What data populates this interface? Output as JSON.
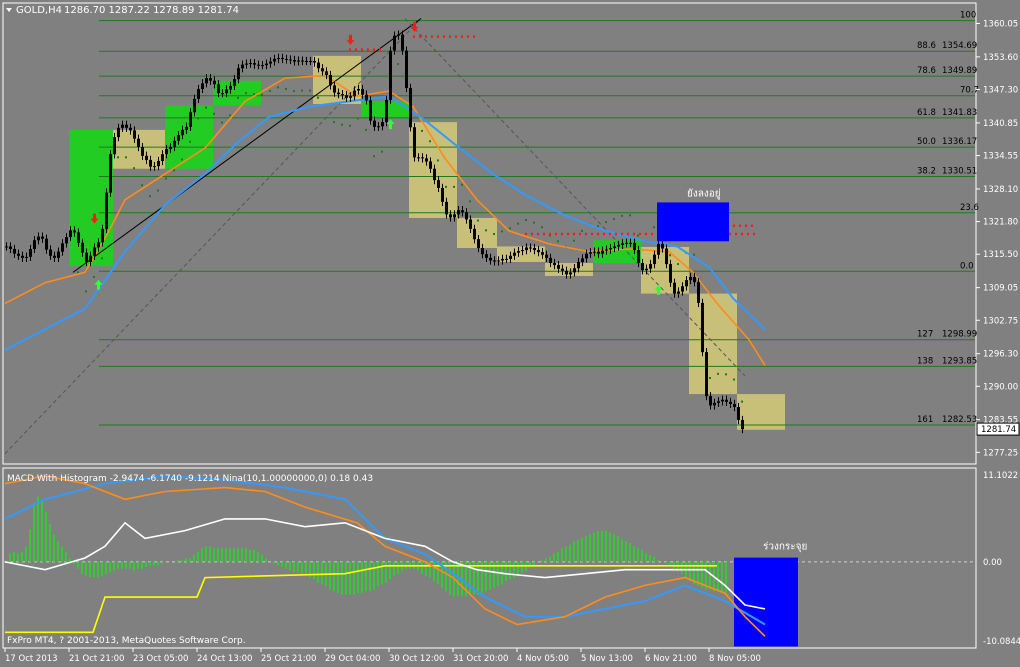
{
  "window": {
    "symbol_title": "GOLD,H4",
    "ohlc": "1286.70 1287.22 1278.89 1281.74",
    "copyright": "FxPro MT4, ? 2001-2013, MetaQuotes Software Corp."
  },
  "colors": {
    "background": "#808080",
    "bull_box": "#22cc22",
    "bear_box": "#c8bf78",
    "grid_level": "#1f7a1f",
    "candle": "#000000",
    "ma_fast": "#ff8c1a",
    "ma_slow": "#3399ff",
    "psar": "#1f7a1f",
    "signal_down": "#ff1a1a",
    "signal_up": "#33ff33",
    "zone": "#0000ff",
    "macd_signal": "#ffffff",
    "macd_yellow": "#ffff00",
    "macd_hist": "#33cc33"
  },
  "chart_data": [
    {
      "type": "candlestick",
      "panel": "price",
      "ylim": [
        1275.0,
        1364.0
      ],
      "y_ticks": [
        1360.05,
        1353.6,
        1347.3,
        1340.85,
        1334.55,
        1328.1,
        1321.8,
        1315.5,
        1309.05,
        1302.75,
        1296.3,
        1290.0,
        1283.55,
        1277.25
      ],
      "current_price": "1281.74",
      "x_ticks": [
        "17 Oct 2013",
        "21 Oct 21:00",
        "23 Oct 05:00",
        "24 Oct 13:00",
        "25 Oct 21:00",
        "29 Oct 04:00",
        "30 Oct 12:00",
        "31 Oct 20:00",
        "4 Nov 05:00",
        "5 Nov 13:00",
        "6 Nov 21:00",
        "8 Nov 05:00"
      ],
      "x_tick_index": [
        0,
        16,
        32,
        48,
        64,
        80,
        96,
        112,
        128,
        144,
        160,
        176
      ],
      "fib_levels": [
        {
          "label": "100",
          "price": 1360.6
        },
        {
          "label": "88.6",
          "value": "1354.69",
          "price": 1354.69
        },
        {
          "label": "78.6",
          "value": "1349.89",
          "price": 1349.89
        },
        {
          "label": "70.7",
          "price": 1346.1
        },
        {
          "label": "61.8",
          "value": "1341.83",
          "price": 1341.83
        },
        {
          "label": "50.0",
          "value": "1336.17",
          "price": 1336.17
        },
        {
          "label": "38.2",
          "value": "1330.51",
          "price": 1330.51
        },
        {
          "label": "23.6",
          "price": 1323.5
        },
        {
          "label": "0.0",
          "price": 1312.2
        },
        {
          "label": "127",
          "value": "1298.99",
          "price": 1298.99
        },
        {
          "label": "138",
          "value": "1293.85",
          "price": 1293.85
        },
        {
          "label": "161",
          "value": "1282.53",
          "price": 1282.53
        }
      ],
      "boxes": [
        {
          "kind": "bull",
          "i0": 16,
          "i1": 27,
          "low": 1313.2,
          "high": 1339.5
        },
        {
          "kind": "bear",
          "i0": 27,
          "i1": 40,
          "low": 1332.0,
          "high": 1339.5
        },
        {
          "kind": "bull",
          "i0": 40,
          "i1": 52,
          "low": 1332.0,
          "high": 1344.2
        },
        {
          "kind": "bull",
          "i0": 52,
          "i1": 64,
          "low": 1344.2,
          "high": 1349.0
        },
        {
          "kind": "bear",
          "i0": 77,
          "i1": 89,
          "low": 1344.5,
          "high": 1353.8
        },
        {
          "kind": "bull",
          "i0": 89,
          "i1": 101,
          "low": 1342.0,
          "high": 1345.0
        },
        {
          "kind": "bear",
          "i0": 101,
          "i1": 113,
          "low": 1322.5,
          "high": 1341.0
        },
        {
          "kind": "bear",
          "i0": 113,
          "i1": 123,
          "low": 1316.7,
          "high": 1322.5
        },
        {
          "kind": "bear",
          "i0": 123,
          "i1": 135,
          "low": 1314.0,
          "high": 1317.0
        },
        {
          "kind": "bear",
          "i0": 135,
          "i1": 147,
          "low": 1311.3,
          "high": 1313.8
        },
        {
          "kind": "bull",
          "i0": 147,
          "i1": 159,
          "low": 1313.8,
          "high": 1318.2
        },
        {
          "kind": "bear",
          "i0": 159,
          "i1": 171,
          "low": 1307.9,
          "high": 1316.9
        },
        {
          "kind": "bear",
          "i0": 171,
          "i1": 183,
          "low": 1288.5,
          "high": 1307.9
        },
        {
          "kind": "bear",
          "i0": 183,
          "i1": 195,
          "low": 1281.6,
          "high": 1288.5
        }
      ],
      "zone": {
        "i0": 163,
        "i1": 181,
        "low": 1318.0,
        "high": 1325.5,
        "label": "ยังลงอยู่"
      },
      "closes": [
        1317.0,
        1316.5,
        1315.6,
        1315.2,
        1314.8,
        1315.0,
        1316.5,
        1318.2,
        1318.9,
        1318.5,
        1316.4,
        1315.2,
        1314.8,
        1316.0,
        1317.6,
        1318.8,
        1320.1,
        1319.7,
        1317.7,
        1315.8,
        1314.0,
        1315.2,
        1316.8,
        1317.8,
        1320.4,
        1327.4,
        1334.8,
        1338.1,
        1339.9,
        1340.5,
        1339.9,
        1339.4,
        1337.8,
        1336.2,
        1334.5,
        1333.7,
        1332.4,
        1332.5,
        1333.5,
        1334.8,
        1335.8,
        1336.2,
        1337.4,
        1338.5,
        1339.5,
        1340.1,
        1342.9,
        1345.5,
        1347.4,
        1348.5,
        1349.5,
        1349.0,
        1348.3,
        1346.6,
        1346.6,
        1347.3,
        1348.0,
        1349.3,
        1351.4,
        1352.1,
        1352.3,
        1352.4,
        1352.1,
        1352.0,
        1352.0,
        1352.3,
        1352.7,
        1353.2,
        1353.4,
        1353.2,
        1353.1,
        1353.0,
        1352.7,
        1352.9,
        1352.8,
        1352.8,
        1352.8,
        1352.5,
        1351.4,
        1350.8,
        1350.1,
        1348.1,
        1346.7,
        1346.4,
        1346.2,
        1345.7,
        1346.0,
        1347.1,
        1347.4,
        1346.3,
        1345.2,
        1341.3,
        1340.1,
        1340.2,
        1341.0,
        1345.3,
        1354.8,
        1357.7,
        1357.9,
        1354.8,
        1347.6,
        1340.0,
        1334.2,
        1334.2,
        1334.0,
        1333.4,
        1332.0,
        1329.8,
        1328.3,
        1325.6,
        1323.2,
        1322.6,
        1323.2,
        1324.0,
        1323.6,
        1322.2,
        1320.4,
        1318.4,
        1316.7,
        1315.5,
        1314.8,
        1314.3,
        1314.1,
        1314.3,
        1314.6,
        1314.6,
        1315.2,
        1315.8,
        1316.1,
        1316.3,
        1316.8,
        1316.7,
        1316.3,
        1315.9,
        1315.4,
        1314.8,
        1313.8,
        1313.4,
        1312.7,
        1312.3,
        1311.6,
        1312.0,
        1312.8,
        1314.0,
        1314.7,
        1315.6,
        1315.9,
        1316.0,
        1315.6,
        1316.2,
        1316.4,
        1316.7,
        1317.0,
        1317.3,
        1317.6,
        1317.7,
        1317.7,
        1316.3,
        1313.8,
        1312.4,
        1312.7,
        1313.6,
        1315.4,
        1317.5,
        1316.6,
        1313.6,
        1310.0,
        1307.9,
        1308.3,
        1309.3,
        1310.5,
        1311.1,
        1310.1,
        1306.1,
        1296.6,
        1288.1,
        1286.3,
        1286.8,
        1287.1,
        1287.4,
        1287.0,
        1286.6,
        1286.0,
        1283.5,
        1281.74
      ],
      "ma_fast": [
        [
          0,
          1306.0
        ],
        [
          10,
          1310.0
        ],
        [
          20,
          1312.0
        ],
        [
          26,
          1320.0
        ],
        [
          30,
          1326.0
        ],
        [
          40,
          1331.0
        ],
        [
          50,
          1336.0
        ],
        [
          60,
          1345.0
        ],
        [
          70,
          1349.5
        ],
        [
          80,
          1350.0
        ],
        [
          88,
          1346.0
        ],
        [
          96,
          1347.0
        ],
        [
          102,
          1344.0
        ],
        [
          110,
          1334.0
        ],
        [
          118,
          1326.0
        ],
        [
          126,
          1320.0
        ],
        [
          136,
          1317.5
        ],
        [
          146,
          1316.0
        ],
        [
          156,
          1316.5
        ],
        [
          166,
          1316.0
        ],
        [
          172,
          1312.0
        ],
        [
          178,
          1306.0
        ],
        [
          186,
          1299.0
        ],
        [
          190,
          1294.0
        ]
      ],
      "ma_slow": [
        [
          0,
          1297.0
        ],
        [
          10,
          1301.0
        ],
        [
          20,
          1305.0
        ],
        [
          30,
          1316.0
        ],
        [
          40,
          1325.0
        ],
        [
          50,
          1331.0
        ],
        [
          58,
          1337.0
        ],
        [
          66,
          1342.0
        ],
        [
          76,
          1344.0
        ],
        [
          86,
          1345.0
        ],
        [
          96,
          1346.0
        ],
        [
          104,
          1342.0
        ],
        [
          112,
          1337.0
        ],
        [
          122,
          1331.0
        ],
        [
          130,
          1327.0
        ],
        [
          140,
          1323.0
        ],
        [
          150,
          1320.0
        ],
        [
          160,
          1318.0
        ],
        [
          168,
          1317.0
        ],
        [
          176,
          1313.0
        ],
        [
          182,
          1307.0
        ],
        [
          190,
          1301.0
        ]
      ],
      "trend_lines": [
        {
          "from": [
            0,
            1277.0
          ],
          "to": [
            104,
            1361.0
          ],
          "style": "dashed"
        },
        {
          "from": [
            17,
            1312.0
          ],
          "to": [
            104,
            1361.0
          ],
          "style": "solid"
        },
        {
          "from": [
            100,
            1361.0
          ],
          "to": [
            185,
            1292.0
          ],
          "style": "dashed"
        }
      ],
      "dotted_levels": [
        {
          "i0": 86,
          "i1": 95,
          "price": 1355.0
        },
        {
          "i0": 102,
          "i1": 118,
          "price": 1357.5
        },
        {
          "i0": 130,
          "i1": 188,
          "price": 1319.4
        },
        {
          "i0": 167,
          "i1": 188,
          "price": 1321.0
        }
      ],
      "arrows": [
        {
          "dir": "down",
          "i": 22,
          "price": 1322.0
        },
        {
          "dir": "up",
          "i": 23,
          "price": 1310.0
        },
        {
          "dir": "down",
          "i": 86,
          "price": 1356.5
        },
        {
          "dir": "up",
          "i": 96,
          "price": 1341.0
        },
        {
          "dir": "down",
          "i": 102,
          "price": 1359.0
        },
        {
          "dir": "up",
          "i": 163,
          "price": 1309.0
        },
        {
          "dir": "down",
          "i": 168,
          "price": 1321.0
        }
      ]
    },
    {
      "type": "macd",
      "panel": "indicator",
      "title": "MACD With Histogram -2.9474 -6.1740 -9.1214  Nina(10,1.00000000,0) 0.18 0.43",
      "ylim": [
        -11.0,
        12.0
      ],
      "y_ticks": [
        "11.1022",
        "0.00",
        "-10.0844"
      ],
      "y_tick_values": [
        11.1022,
        0.0,
        -10.0844
      ],
      "zone": {
        "i0": 183,
        "i1": 199,
        "low": -10.8,
        "high": 0.55,
        "label": "ร่วงกระจุย"
      },
      "macd_blue": [
        [
          0,
          5.5
        ],
        [
          10,
          8.0
        ],
        [
          25,
          10.0
        ],
        [
          40,
          11.0
        ],
        [
          55,
          10.5
        ],
        [
          70,
          9.5
        ],
        [
          85,
          8.0
        ],
        [
          95,
          3.0
        ],
        [
          105,
          1.0
        ],
        [
          112,
          -1.5
        ],
        [
          120,
          -4.5
        ],
        [
          130,
          -7.0
        ],
        [
          140,
          -7.0
        ],
        [
          150,
          -6.0
        ],
        [
          160,
          -5.0
        ],
        [
          170,
          -3.0
        ],
        [
          180,
          -5.0
        ],
        [
          190,
          -8.0
        ]
      ],
      "macd_orange": [
        [
          0,
          10.0
        ],
        [
          10,
          11.0
        ],
        [
          20,
          10.0
        ],
        [
          30,
          8.0
        ],
        [
          40,
          9.0
        ],
        [
          55,
          9.5
        ],
        [
          65,
          9.0
        ],
        [
          75,
          7.0
        ],
        [
          88,
          5.0
        ],
        [
          95,
          2.0
        ],
        [
          105,
          0.0
        ],
        [
          112,
          -2.0
        ],
        [
          120,
          -6.0
        ],
        [
          128,
          -8.0
        ],
        [
          140,
          -7.0
        ],
        [
          150,
          -4.5
        ],
        [
          160,
          -3.0
        ],
        [
          170,
          -2.0
        ],
        [
          180,
          -4.0
        ],
        [
          185,
          -7.0
        ],
        [
          190,
          -9.5
        ]
      ],
      "macd_white": [
        [
          0,
          0.0
        ],
        [
          10,
          -1.0
        ],
        [
          20,
          0.5
        ],
        [
          25,
          2.0
        ],
        [
          30,
          5.0
        ],
        [
          35,
          3.0
        ],
        [
          45,
          4.0
        ],
        [
          55,
          5.5
        ],
        [
          65,
          5.5
        ],
        [
          75,
          4.5
        ],
        [
          85,
          5.0
        ],
        [
          95,
          3.0
        ],
        [
          105,
          2.0
        ],
        [
          112,
          0.0
        ],
        [
          118,
          -1.0
        ],
        [
          125,
          -1.5
        ],
        [
          135,
          -2.0
        ],
        [
          145,
          -1.5
        ],
        [
          155,
          -1.0
        ],
        [
          165,
          -1.0
        ],
        [
          175,
          -1.0
        ],
        [
          180,
          -3.0
        ],
        [
          185,
          -5.5
        ],
        [
          190,
          -6.0
        ]
      ],
      "macd_yellow": [
        [
          0,
          -9.0
        ],
        [
          22,
          -9.0
        ],
        [
          25,
          -4.5
        ],
        [
          48,
          -4.5
        ],
        [
          50,
          -2.0
        ],
        [
          85,
          -1.5
        ],
        [
          95,
          -0.5
        ],
        [
          118,
          -0.5
        ],
        [
          178,
          -0.5
        ]
      ],
      "histogram": [
        0.0,
        0.5,
        0.6,
        0.5,
        0.6,
        0.9,
        1.9,
        3.4,
        3.8,
        3.6,
        2.9,
        2.2,
        1.6,
        1.2,
        0.9,
        0.6,
        0.2,
        -0.1,
        -0.4,
        -0.7,
        -0.8,
        -0.9,
        -0.9,
        -0.9,
        -0.8,
        -0.7,
        -0.6,
        -0.5,
        -0.4,
        -0.4,
        -0.4,
        -0.4,
        -0.5,
        -0.4,
        -0.4,
        -0.3,
        -0.2,
        -0.2,
        -0.2,
        -0.1,
        -0.0,
        -0.0,
        0.0,
        0.1,
        0.1,
        0.2,
        0.2,
        0.4,
        0.6,
        0.8,
        0.9,
        0.9,
        0.8,
        0.8,
        0.8,
        0.8,
        0.8,
        0.8,
        0.8,
        0.8,
        0.8,
        0.7,
        0.7,
        0.6,
        0.4,
        0.2,
        -0.0,
        -0.1,
        -0.2,
        -0.3,
        -0.4,
        -0.5,
        -0.6,
        -0.6,
        -0.7,
        -0.8,
        -0.9,
        -1.0,
        -1.2,
        -1.3,
        -1.4,
        -1.6,
        -1.7,
        -1.8,
        -1.9,
        -1.9,
        -1.9,
        -1.9,
        -1.8,
        -1.8,
        -1.7,
        -1.7,
        -1.6,
        -1.4,
        -1.3,
        -1.2,
        -1.0,
        -0.8,
        -0.7,
        -0.5,
        -0.4,
        -0.4,
        -0.4,
        -0.5,
        -0.7,
        -0.8,
        -0.9,
        -1.1,
        -1.3,
        -1.5,
        -1.7,
        -1.9,
        -2.0,
        -2.0,
        -2.0,
        -2.0,
        -1.9,
        -1.9,
        -1.9,
        -1.8,
        -1.7,
        -1.6,
        -1.5,
        -1.4,
        -1.3,
        -1.1,
        -1.0,
        -0.9,
        -0.8,
        -0.6,
        -0.5,
        -0.3,
        -0.2,
        -0.0,
        0.1,
        0.2,
        0.3,
        0.5,
        0.6,
        0.8,
        0.9,
        1.0,
        1.2,
        1.3,
        1.4,
        1.5,
        1.6,
        1.7,
        1.8,
        1.8,
        1.8,
        1.7,
        1.6,
        1.5,
        1.3,
        1.2,
        1.1,
        0.9,
        0.8,
        0.7,
        0.5,
        0.4,
        0.3,
        0.1,
        0.0,
        -0.1,
        -0.2,
        -0.4,
        -0.5,
        -0.7,
        -0.9,
        -1.1,
        -1.3,
        -1.4,
        -1.5,
        -1.6,
        -1.6,
        -1.7,
        -1.7,
        -1.8,
        -1.8
      ]
    }
  ]
}
